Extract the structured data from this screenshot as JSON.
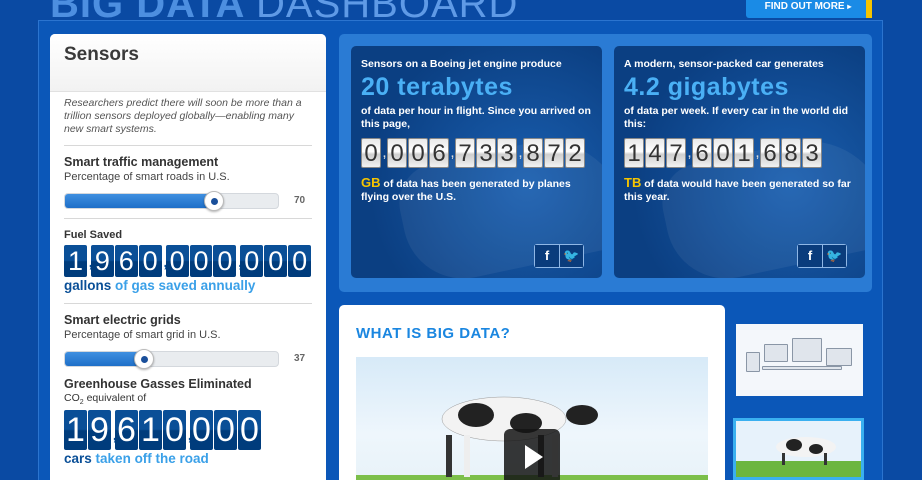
{
  "header": {
    "title_bold": "BIG DATA",
    "title_light": "DASHBOARD",
    "cta_label": "FIND OUT MORE",
    "cta_arrow": "▸"
  },
  "sensors": {
    "heading": "Sensors",
    "intro": "Researchers predict there will soon be more than a trillion sensors deployed globally—enabling many new smart systems.",
    "traffic": {
      "title": "Smart traffic management",
      "subtitle": "Percentage of smart roads in U.S.",
      "value": 70,
      "value_label": "70"
    },
    "fuel": {
      "label": "Fuel Saved",
      "digits": [
        "1",
        ",",
        "9",
        "6",
        "0",
        ",",
        "0",
        "0",
        "0",
        ",",
        "0",
        "0",
        "0"
      ],
      "unit": "gallons",
      "rest": "of gas saved annually"
    },
    "grid": {
      "title": "Smart electric grids",
      "subtitle": "Percentage of smart grid in U.S.",
      "value": 37,
      "value_label": "37"
    },
    "ghg": {
      "title": "Greenhouse Gasses Eliminated",
      "co2_pre": "CO",
      "co2_sub": "2",
      "co2_post": "equivalent of",
      "digits": [
        "1",
        "9",
        ",",
        "6",
        "1",
        "0",
        ",",
        "0",
        "0",
        "0"
      ],
      "unit": "cars",
      "rest": "taken off the road"
    }
  },
  "cards": [
    {
      "pre": "Sensors on a Boeing jet engine produce",
      "big": "20 terabytes",
      "mid": "of data per hour in flight. Since you arrived on this page,",
      "digits": [
        "0",
        ",",
        "0",
        "0",
        "6",
        ",",
        "7",
        "3",
        "3",
        ",",
        "8",
        "7",
        "2"
      ],
      "post_hl": "GB",
      "post": "of data has been generated by planes flying over the U.S.",
      "share_fb": "f",
      "share_tw": "🐦"
    },
    {
      "pre": "A modern, sensor-packed car generates",
      "big": "4.2 gigabytes",
      "mid": "of data per week. If every car in the world did this:",
      "digits": [
        "1",
        "4",
        "7",
        ",",
        "6",
        "0",
        "1",
        ",",
        "6",
        "8",
        "3"
      ],
      "post_hl": "TB",
      "post": "of data would have been generated so far this year.",
      "share_fb": "f",
      "share_tw": "🐦"
    }
  ],
  "video": {
    "title": "WHAT IS BIG DATA?"
  },
  "colors": {
    "background": "#0a4aa3",
    "accent_blue": "#4ab0f5",
    "highlight_yellow": "#f5c400",
    "digit_tile": "#0a4f97"
  }
}
